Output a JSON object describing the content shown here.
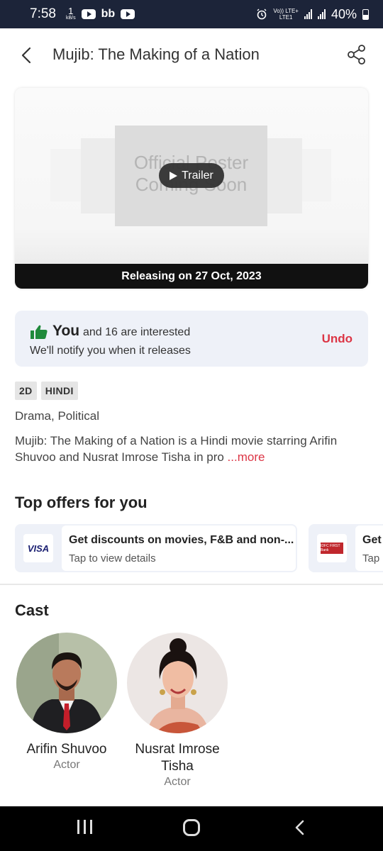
{
  "status_bar": {
    "time": "7:58",
    "net_speed_value": "1",
    "net_speed_unit": "kB/s",
    "volte": "Vo)) LTE+",
    "lte": "LTE1",
    "battery": "40%"
  },
  "header": {
    "title": "Mujib: The Making of a Nation"
  },
  "poster": {
    "placeholder_line1": "Official Poster",
    "placeholder_line2": "Coming Soon",
    "trailer_label": "Trailer",
    "release_label": "Releasing on 27 Oct, 2023"
  },
  "interest": {
    "you_label": "You",
    "count_text": "and 16 are interested",
    "notify_text": "We'll notify you when it releases",
    "undo_label": "Undo"
  },
  "tags": [
    "2D",
    "HINDI"
  ],
  "genres": "Drama, Political",
  "synopsis": {
    "text": "Mujib: The Making of a Nation is a Hindi movie starring Arifin Shuvoo and Nusrat Imrose Tisha in pro ",
    "more_label": "...more"
  },
  "offers": {
    "title": "Top offers for you",
    "items": [
      {
        "logo": "VISA",
        "title": "Get discounts on movies, F&B and non-...",
        "subtitle": "Tap to view details"
      },
      {
        "logo": "IDFC FIRST Bank",
        "title": "Get",
        "subtitle": "Tap"
      }
    ]
  },
  "cast": {
    "title": "Cast",
    "members": [
      {
        "name": "Arifin Shuvoo",
        "role": "Actor"
      },
      {
        "name": "Nusrat Imrose Tisha",
        "role": "Actor"
      }
    ]
  },
  "colors": {
    "accent": "#dc3545",
    "status_bar": "#1c2439",
    "interest_bg": "#eef1f8",
    "thumb_green": "#1f8a3b"
  }
}
